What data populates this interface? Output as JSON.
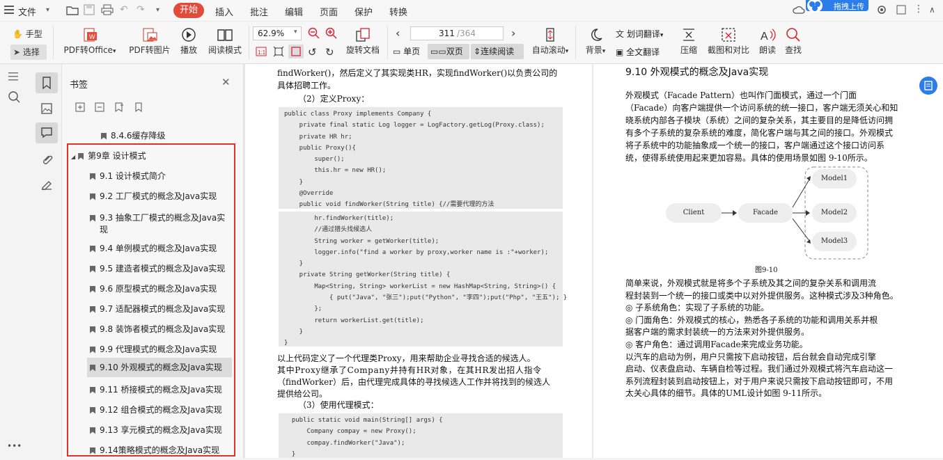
{
  "menu": {
    "file": "文件",
    "tabs": [
      "开始",
      "插入",
      "批注",
      "编辑",
      "页面",
      "保护",
      "转换"
    ],
    "active": "开始"
  },
  "upload_label": "拖拽上传",
  "toolbar": {
    "hand": "手型",
    "select": "选择",
    "pdf_to_office": "PDF转Office",
    "pdf_to_image": "PDF转图片",
    "play": "播放",
    "read_mode": "阅读模式",
    "zoom": "62.9%",
    "rotate": "旋转文档",
    "page_current": "311",
    "page_total": "/364",
    "single": "单页",
    "double": "双页",
    "continuous": "连续阅读",
    "autoscroll": "自动滚动",
    "background": "背景",
    "word_translate": "划词翻译",
    "full_translate": "全文翻译",
    "compress": "压缩",
    "screenshot_compare": "截图和对比",
    "read_aloud": "朗读",
    "find": "查找"
  },
  "bookmarks": {
    "title": "书签",
    "items": [
      {
        "label": "8.4.6缓存降级",
        "level": 2
      },
      {
        "label": "第9章  设计模式",
        "level": 1
      },
      {
        "label": "9.1  设计模式简介",
        "level": 2
      },
      {
        "label": "9.2  工厂模式的概念及Java实现",
        "level": 2
      },
      {
        "label": "9.3  抽象工厂模式的概念及Java实",
        "label2": "现",
        "level": 2
      },
      {
        "label": "9.4  单例模式的概念及Java实现",
        "level": 2
      },
      {
        "label": "9.5  建造者模式的概念及Java实现",
        "level": 2
      },
      {
        "label": "9.6  原型模式的概念及Java实现",
        "level": 2
      },
      {
        "label": "9.7  适配器模式的概念及Java实现",
        "level": 2
      },
      {
        "label": "9.8  装饰者模式的概念及Java实现",
        "level": 2
      },
      {
        "label": "9.9  代理模式的概念及Java实现",
        "level": 2
      },
      {
        "label": "9.10  外观模式的概念及Java实现",
        "level": 2,
        "selected": true
      },
      {
        "label": "9.11  桥接模式的概念及Java实现",
        "level": 2
      },
      {
        "label": "9.12  组合模式的概念及Java实现",
        "level": 2
      },
      {
        "label": "9.13  享元模式的概念及Java实现",
        "level": 2
      },
      {
        "label": "9.14策略模式的概念及Java实现",
        "level": 2
      }
    ]
  },
  "left_page": {
    "p1": "findWorker()，然后定义了其实现类HR，实现findWorker()以负责公司的",
    "p2": "具体招聘工作。",
    "h2": "（2）定义Proxy：",
    "code1": [
      "public class Proxy implements Company {",
      "    private final static Log logger = LogFactory.getLog(Proxy.class);",
      "    private HR hr;",
      "    public Proxy(){",
      "        super();",
      "        this.hr = new HR();",
      "    }",
      "    @Override",
      "    public void findWorker(String title) {//需要代理的方法"
    ],
    "code2": [
      "        hr.findWorker(title);",
      "        //通过猎头找候选人",
      "        String worker = getWorker(title);",
      "        logger.info(\"find a worker by proxy,worker name is :\"+worker);",
      "    }",
      "    private String getWorker(String title) {",
      "        Map<String, String> workerList = new HashMap<String, String>() {",
      "            { put(\"Java\", \"张三\");put(\"Python\", \"李四\");put(\"Php\", \"王五\"); }",
      "        };",
      "        return workerList.get(title);",
      "    }",
      "}"
    ],
    "p3": "    以上代码定义了一个代理类Proxy，用来帮助企业寻找合适的候选人。",
    "p4": "其中Proxy继承了Company并持有HR对象，在其HR发出招人指令",
    "p5": "（findWorker）后，由代理完成具体的寻找候选人工作并将找到的候选人",
    "p6": "提供给公司。",
    "h3": "（3）使用代理模式：",
    "code3": [
      "  public static void main(String[] args) {",
      "      Company compay = new Proxy();",
      "      compay.findWorker(\"Java\");",
      "  }"
    ]
  },
  "right_page": {
    "heading": "9.10  外观模式的概念及Java实现",
    "lines": [
      "    外观模式（Facade Pattern）也叫作门面模式，通过一个门面",
      "（Facade）向客户端提供一个访问系统的统一接口，客户端无须关心和知",
      "晓系统内部各子模块（系统）之间的复杂关系，其主要目的是降低访问拥",
      "有多个子系统的复杂系统的难度，简化客户端与其之间的接口。外观模式",
      "将子系统中的功能抽象成一个统一的接口，客户端通过这个接口访问系",
      "统，使得系统使用起来更加容易。具体的使用场景如图 9-10所示。"
    ],
    "diagram": {
      "client": "Client",
      "facade": "Facade",
      "m1": "Model1",
      "m2": "Model2",
      "m3": "Model3",
      "caption": "图9-10"
    },
    "lines2": [
      "    简单来说，外观模式就是将多个子系统及其之间的复杂关系和调用流",
      "程封装到一个统一的接口或类中以对外提供服务。这种模式涉及3种角色。",
      "    ◎  子系统角色：实现了子系统的功能。",
      "    ◎  门面角色：外观模式的核心，熟悉各子系统的功能和调用关系并根",
      "据客户端的需求封装统一的方法来对外提供服务。",
      "    ◎  客户角色：通过调用Facade来完成业务功能。",
      "    以汽车的启动为例，用户只需按下启动按钮，后台就会自动完成引擎",
      "启动、仪表盘启动、车辆自检等过程。我们通过外观模式将汽车启动这一",
      "系列流程封装到启动按钮上，对于用户来说只需按下启动按钮即可，不用",
      "太关心具体的细节。具体的UML设计如图 9-11所示。"
    ]
  },
  "colors": {
    "accent": "#e14b3b",
    "highlight": "#e0302a",
    "upload": "#2b7de9"
  }
}
